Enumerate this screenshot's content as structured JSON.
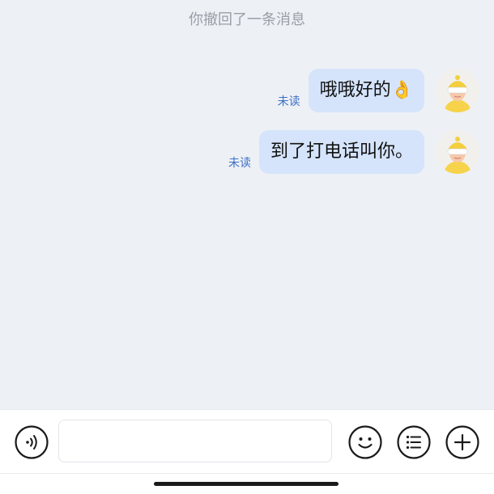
{
  "system_note": "你撤回了一条消息",
  "messages": [
    {
      "text": "哦哦好的👌",
      "status": "未读"
    },
    {
      "text": "到了打电话叫你。",
      "status": "未读"
    }
  ],
  "input": {
    "value": "",
    "placeholder": ""
  },
  "toolbar": {
    "icons": [
      "voice-icon",
      "emoji-icon",
      "list-icon",
      "plus-icon"
    ]
  },
  "colors": {
    "background": "#edf0f5",
    "bubble": "#d5e4fb",
    "unread_text": "#3d6fc6",
    "system_text": "#9a9ea6"
  }
}
